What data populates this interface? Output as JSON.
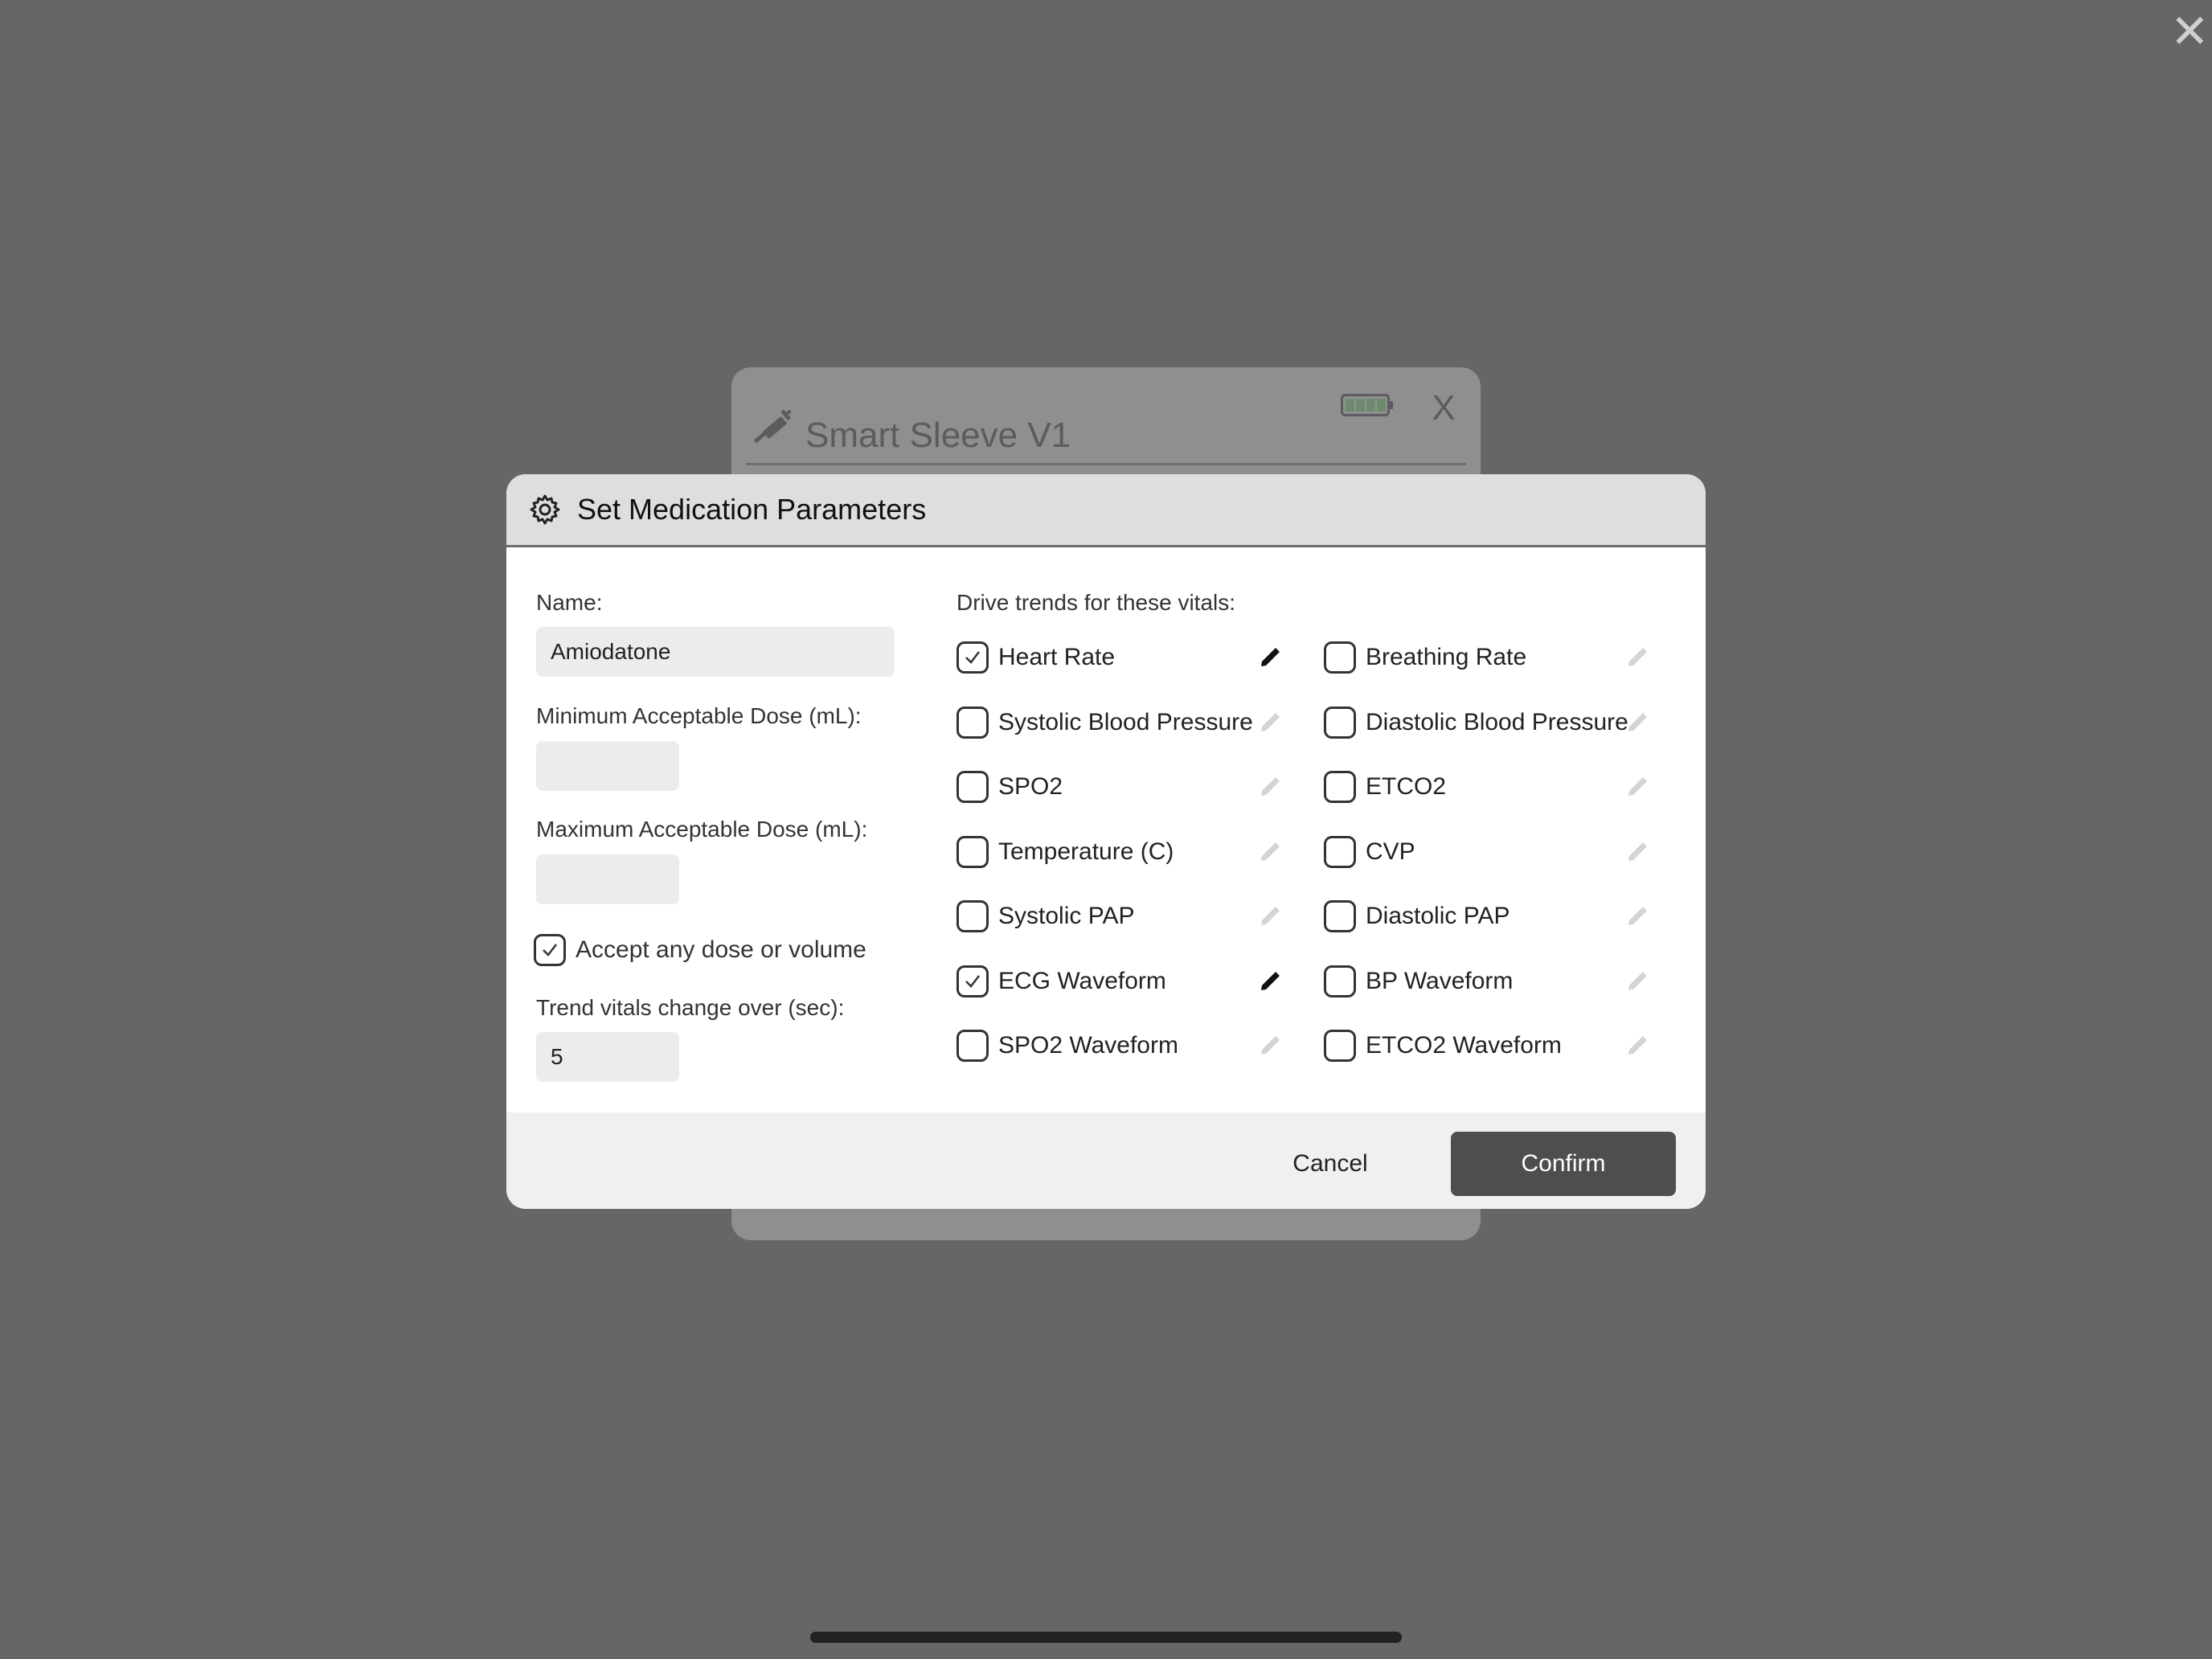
{
  "background_card": {
    "title": "Smart Sleeve V1",
    "close_label": "X"
  },
  "top_close_label": "✕",
  "modal": {
    "title": "Set Medication Parameters",
    "name_label": "Name:",
    "name_value": "Amiodatone",
    "min_dose_label": "Minimum Acceptable Dose (mL):",
    "min_dose_value": "",
    "max_dose_label": "Maximum Acceptable Dose (mL):",
    "max_dose_value": "",
    "accept_any_label": "Accept any dose or volume",
    "accept_any_checked": true,
    "trend_label": "Trend vitals change over (sec):",
    "trend_value": "5",
    "vitals_heading": "Drive trends for these vitals:",
    "vitals": [
      {
        "label": "Heart Rate",
        "checked": true
      },
      {
        "label": "Breathing Rate",
        "checked": false
      },
      {
        "label": "Systolic Blood Pressure",
        "checked": false
      },
      {
        "label": "Diastolic Blood Pressure",
        "checked": false
      },
      {
        "label": "SPO2",
        "checked": false
      },
      {
        "label": "ETCO2",
        "checked": false
      },
      {
        "label": "Temperature (C)",
        "checked": false
      },
      {
        "label": "CVP",
        "checked": false
      },
      {
        "label": "Systolic PAP",
        "checked": false
      },
      {
        "label": "Diastolic PAP",
        "checked": false
      },
      {
        "label": "ECG Waveform",
        "checked": true
      },
      {
        "label": "BP Waveform",
        "checked": false
      },
      {
        "label": "SPO2 Waveform",
        "checked": false
      },
      {
        "label": "ETCO2 Waveform",
        "checked": false
      }
    ],
    "cancel_label": "Cancel",
    "confirm_label": "Confirm"
  },
  "colors": {
    "overlay": "#666668",
    "header": "#dedee0",
    "footer": "#f0f0f2",
    "confirm_button": "#4e4e50",
    "pencil_active": "#111111",
    "pencil_inactive": "#d4d4d6"
  }
}
